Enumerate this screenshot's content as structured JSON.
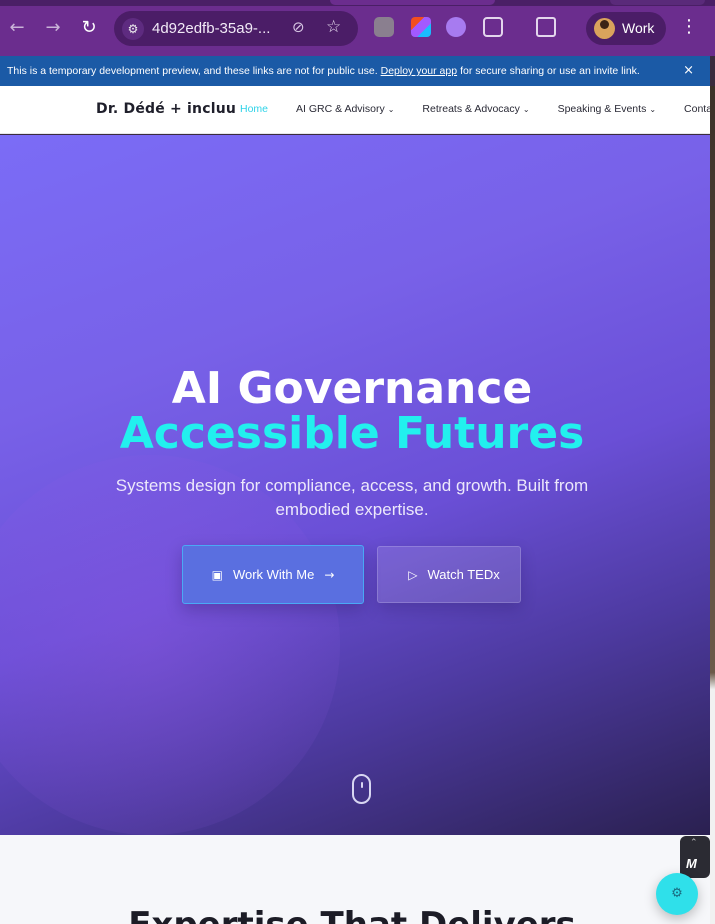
{
  "browser": {
    "url": "4d92edfb-35a9-...",
    "profile_label": "Work",
    "back_icon": "←",
    "forward_icon": "→",
    "reload_icon": "↻",
    "menu_icon": "⋮",
    "star_icon": "☆",
    "eye_icon": "⊘"
  },
  "banner": {
    "text_before": "This is a temporary development preview, and these links are not for public use.",
    "link": "Deploy your app",
    "text_after": "for secure sharing or use an invite link.",
    "close": "×"
  },
  "header": {
    "brand": "Dr. Dédé + incluu",
    "nav": [
      {
        "label": "Home",
        "chevron": ""
      },
      {
        "label": "AI GRC & Advisory",
        "chevron": "⌄"
      },
      {
        "label": "Retreats & Advocacy",
        "chevron": "⌄"
      },
      {
        "label": "Speaking & Events",
        "chevron": "⌄"
      },
      {
        "label": "Conta",
        "chevron": ""
      }
    ]
  },
  "hero": {
    "title_line1": "AI Governance",
    "title_line2": "Accessible Futures",
    "subtitle": "Systems design for compliance, access, and growth. Built from embodied expertise.",
    "primary_button": "Work With Me",
    "secondary_button": "Watch TEDx",
    "calendar_icon": "▣",
    "arrow_icon": "→",
    "play_icon": "▷"
  },
  "next_section": {
    "heading": "Expertise That Delivers"
  },
  "widgets": {
    "scroll_up": "⌃",
    "logo": "M",
    "fab_icon": "⚙"
  }
}
